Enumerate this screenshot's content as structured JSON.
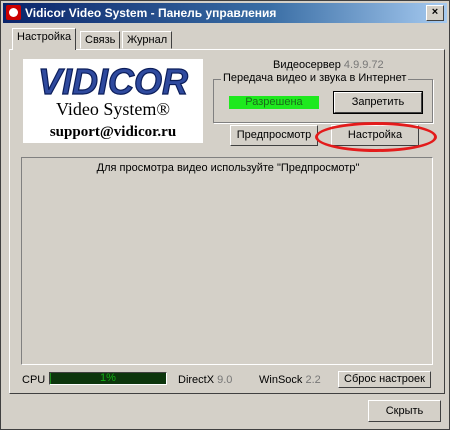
{
  "window": {
    "title": "Vidicor Video System - Панель управления",
    "close_label": "×"
  },
  "tabs": [
    {
      "label": "Настройка",
      "active": true
    },
    {
      "label": "Связь",
      "active": false
    },
    {
      "label": "Журнал",
      "active": false
    }
  ],
  "logo": {
    "wordmark": "VIDICOR",
    "subtitle": "Video System®",
    "email": "support@vidicor.ru"
  },
  "server": {
    "label": "Видеосервер",
    "version": "4.9.9.72"
  },
  "internet": {
    "group_title": "Передача видео и звука в Интернет",
    "status": "Разрешена",
    "status_color": "#1ee91e",
    "block_button": "Запретить"
  },
  "buttons": {
    "preview": "Предпросмотр",
    "settings": "Настройка",
    "reset": "Сброс настроек",
    "hide": "Скрыть"
  },
  "video": {
    "hint": "Для просмотра видео используйте \"Предпросмотр\""
  },
  "status": {
    "cpu_label": "CPU",
    "cpu_value": "1%",
    "cpu_fraction": 0.01,
    "directx_label": "DirectX",
    "directx_value": "9.0",
    "winsock_label": "WinSock",
    "winsock_value": "2.2"
  },
  "colors": {
    "titlebar": "#0a246a",
    "highlight": "#e31b1b",
    "cpu_text": "#13ad13"
  }
}
